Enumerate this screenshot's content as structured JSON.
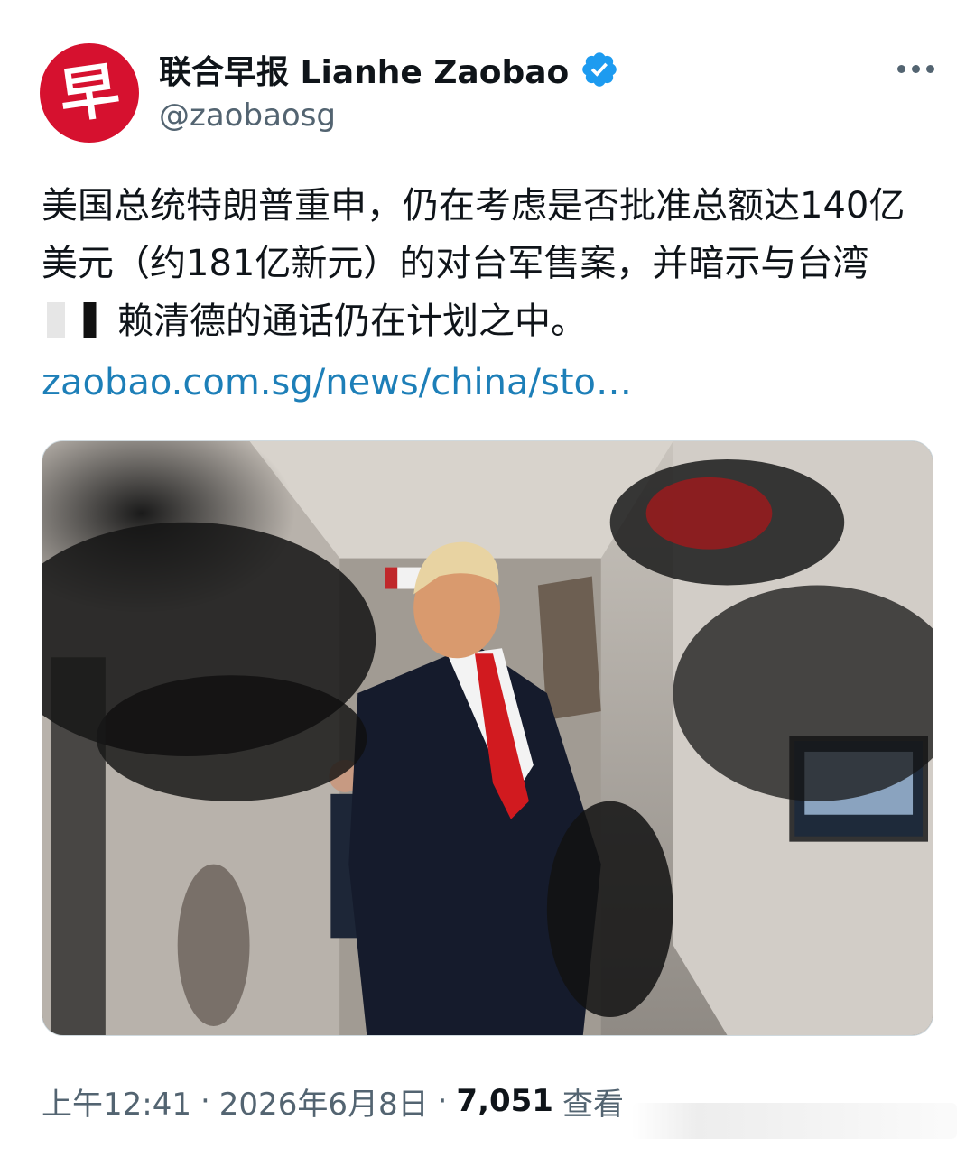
{
  "account": {
    "avatar_glyph": "早",
    "display_name": "联合早报 Lianhe Zaobao",
    "handle": "@zaobaosg",
    "avatar_color": "#d6112f",
    "verified_color": "#1d9bf0"
  },
  "post": {
    "text_before_redaction": "美国总统特朗普重申，仍在考虑是否批准总额达140亿美元（约181亿新元）的对台军售案，并暗示与台湾",
    "text_after_redaction": "赖清德的通话仍在计划之中。",
    "link_text": "zaobao.com.sg/news/china/sto…",
    "link_color": "#1d7fb8"
  },
  "meta": {
    "time": "上午12:41",
    "separator1": "·",
    "date": "2026年6月8日",
    "separator2": "·",
    "views_count": "7,051",
    "views_label": "查看"
  },
  "icons": {
    "more": "more-horizontal-icon",
    "verified": "verified-badge-icon"
  }
}
